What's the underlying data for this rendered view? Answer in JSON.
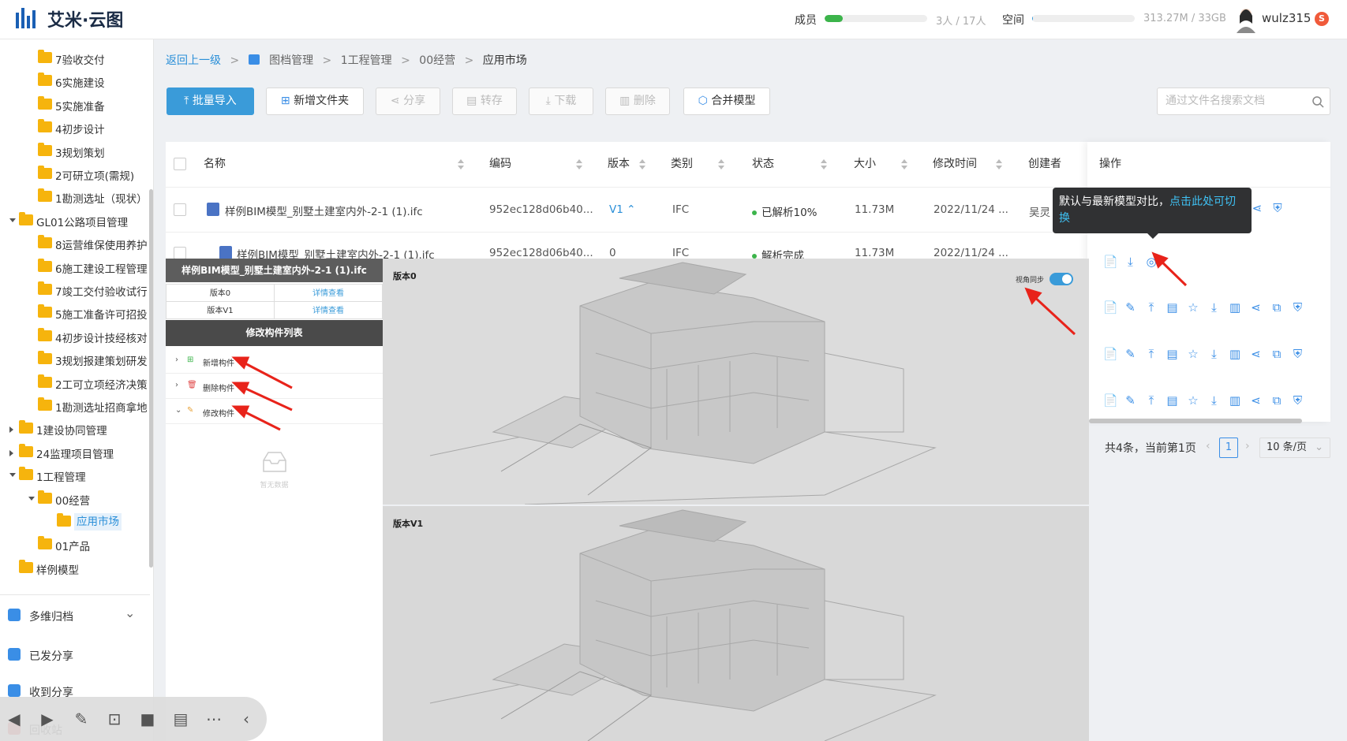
{
  "app": {
    "title": "艾米·云图"
  },
  "topbar": {
    "members_label": "成员",
    "members_value": "3人 / 17人",
    "members_fraction": 0.18,
    "space_label": "空间",
    "space_value": "313.27M / 33GB",
    "space_fraction": 0.01,
    "username": "wulz315",
    "badge": "S"
  },
  "sidebar": {
    "tree": [
      {
        "label": "7验收交付",
        "level": 2
      },
      {
        "label": "6实施建设",
        "level": 2
      },
      {
        "label": "5实施准备",
        "level": 2
      },
      {
        "label": "4初步设计",
        "level": 2
      },
      {
        "label": "3规划策划",
        "level": 2
      },
      {
        "label": "2可研立项(需规)",
        "level": 2
      },
      {
        "label": "1勘测选址（现状）",
        "level": 2
      },
      {
        "label": "GL01公路项目管理",
        "level": 1,
        "expand": "open"
      },
      {
        "label": "8运营维保使用养护",
        "level": 2
      },
      {
        "label": "6施工建设工程管理",
        "level": 2
      },
      {
        "label": "7竣工交付验收试行",
        "level": 2
      },
      {
        "label": "5施工准备许可招投",
        "level": 2
      },
      {
        "label": "4初步设计技经核对",
        "level": 2
      },
      {
        "label": "3规划报建策划研发",
        "level": 2
      },
      {
        "label": "2工可立项经济决策",
        "level": 2
      },
      {
        "label": "1勘测选址招商拿地",
        "level": 2
      },
      {
        "label": "1建设协同管理",
        "level": 1,
        "expand": "closed"
      },
      {
        "label": "24监理项目管理",
        "level": 1,
        "expand": "closed"
      },
      {
        "label": "1工程管理",
        "level": 1,
        "expand": "open"
      },
      {
        "label": "00经营",
        "level": 2,
        "expand": "open"
      },
      {
        "label": "应用市场",
        "level": 3,
        "selected": true
      },
      {
        "label": "01产品",
        "level": 2
      },
      {
        "label": "样例模型",
        "level": 1
      }
    ],
    "nav": [
      {
        "label": "多维归档",
        "has_chevron": true
      },
      {
        "label": "已发分享"
      },
      {
        "label": "收到分享"
      },
      {
        "label": "回收站"
      }
    ]
  },
  "breadcrumb": {
    "back": "返回上一级",
    "items": [
      "图档管理",
      "1工程管理",
      "00经营",
      "应用市场"
    ]
  },
  "toolbar": {
    "batch_import": "批量导入",
    "new_folder": "新增文件夹",
    "share": "分享",
    "transfer": "转存",
    "download": "下载",
    "delete": "删除",
    "merge_model": "合并模型",
    "search_placeholder": "通过文件名搜索文档"
  },
  "table": {
    "columns": [
      "名称",
      "编码",
      "版本",
      "类别",
      "状态",
      "大小",
      "修改时间",
      "创建者",
      "操作"
    ],
    "rows": [
      {
        "name": "样例BIM模型_别墅土建室内外-2-1 (1).ifc",
        "code": "952ec128d06b40...",
        "version": "V1",
        "category": "IFC",
        "status": "已解析10%",
        "size": "11.73M",
        "modified": "2022/11/24 ...",
        "creator": "吴灵"
      },
      {
        "name": "样例BIM模型_别墅土建室内外-2-1 (1).ifc",
        "code": "952ec128d06b40...",
        "version": "0",
        "category": "IFC",
        "status": "解析完成",
        "size": "11.73M",
        "modified": "2022/11/24 ..."
      }
    ]
  },
  "tooltip": {
    "text": "默认与最新模型对比，",
    "link": "点击此处可切换"
  },
  "pagination": {
    "summary": "共4条，当前第1页",
    "current": "1",
    "page_size": "10 条/页"
  },
  "compare": {
    "title": "样例BIM模型_别墅土建室内外-2-1 (1).ifc",
    "versions": [
      {
        "label": "版本0",
        "action": "详情查看"
      },
      {
        "label": "版本V1",
        "action": "详情查看"
      }
    ],
    "list_title": "修改构件列表",
    "groups": [
      {
        "label": "新增构件",
        "color": "#3cb44b",
        "glyph": "⊞",
        "caret": "›"
      },
      {
        "label": "删除构件",
        "color": "#e04848",
        "glyph": "🗑",
        "caret": "›"
      },
      {
        "label": "修改构件",
        "color": "#e8a33a",
        "glyph": "✎",
        "caret": "⌄"
      }
    ],
    "empty_text": "暂无数据"
  },
  "viewer": {
    "top_label": "版本0",
    "bottom_label": "版本V1",
    "sync_label": "视角同步",
    "sync_on": true
  },
  "colors": {
    "accent": "#3a9bd9",
    "link": "#2a8fd8",
    "folder": "#f6b40d",
    "annotation": "#e8231a"
  }
}
